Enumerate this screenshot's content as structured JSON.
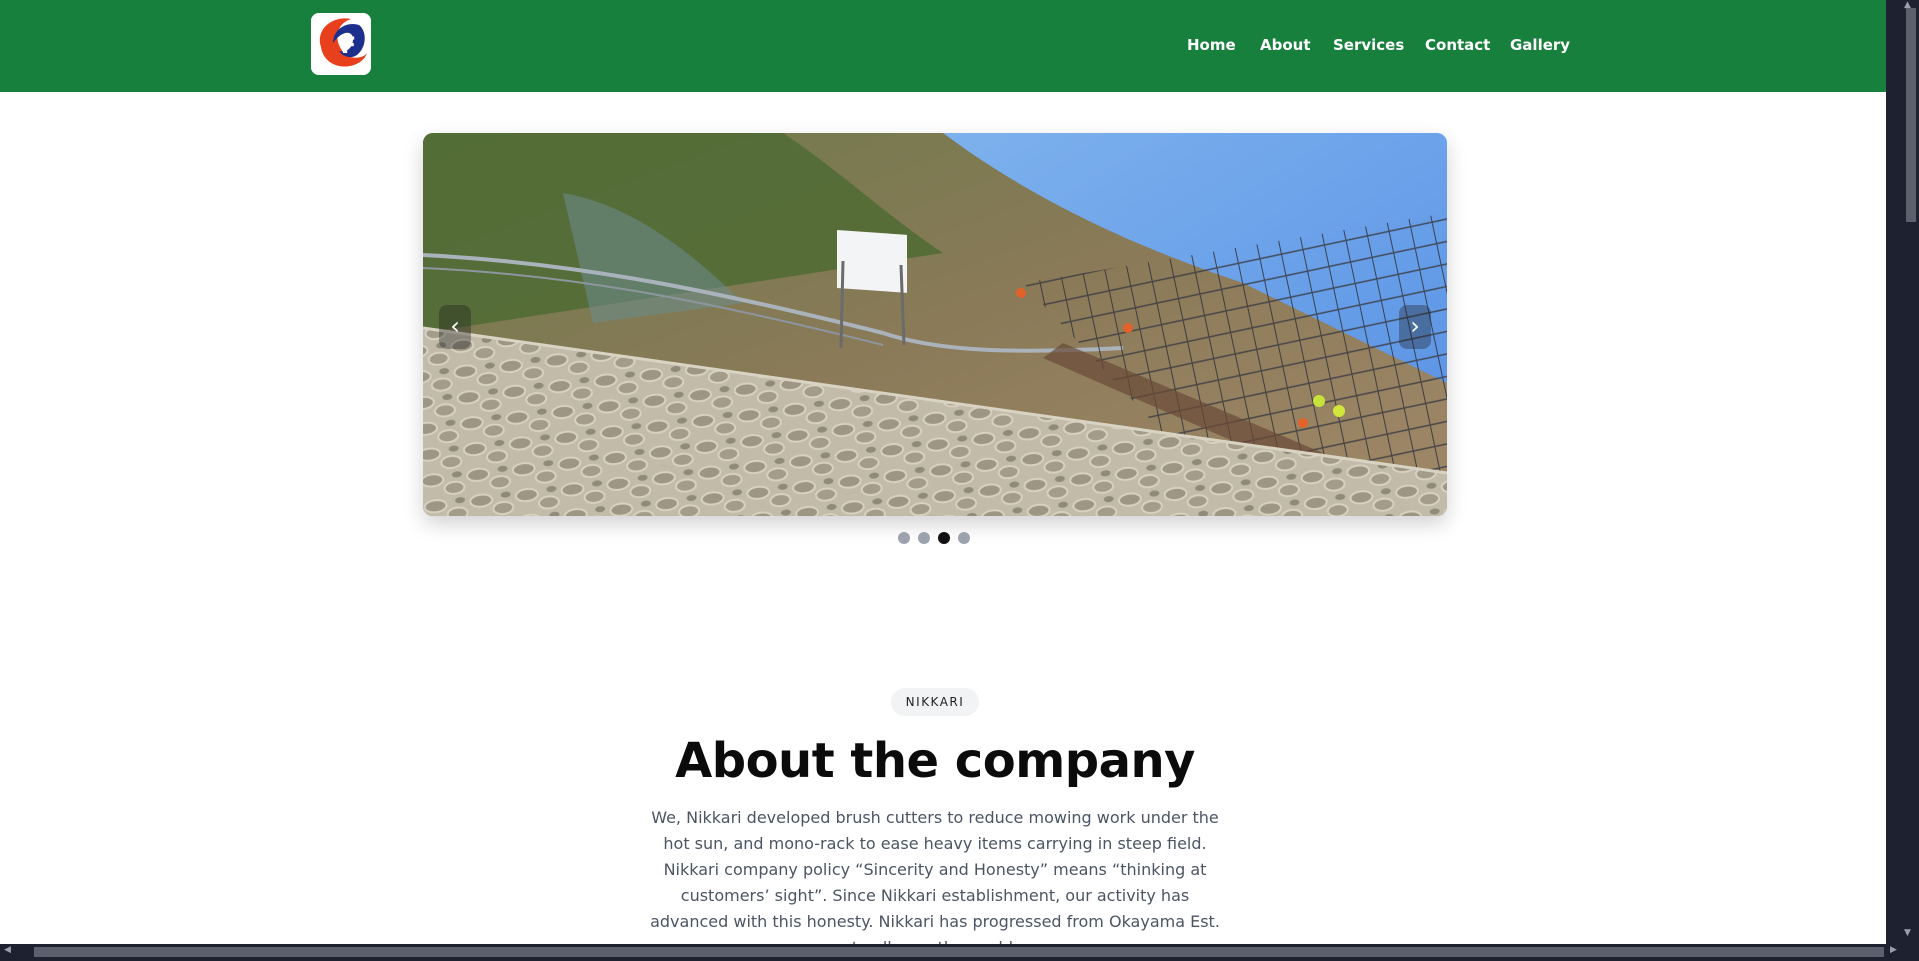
{
  "header": {
    "logo_alt": "Nikkari logo",
    "nav": [
      {
        "label": "Home"
      },
      {
        "label": "About"
      },
      {
        "label": "Services"
      },
      {
        "label": "Contact"
      },
      {
        "label": "Gallery"
      }
    ]
  },
  "carousel": {
    "prev_icon": "‹",
    "next_icon": "›",
    "slide_count": 4,
    "active_slide": 3
  },
  "about": {
    "badge": "NIKKARI",
    "title": "About the company",
    "text": "We, Nikkari developed brush cutters to reduce mowing work under the hot sun, and mono-rack to ease heavy items carrying in steep field. Nikkari company policy “Sincerity and Honesty” means “thinking at customers’ sight”. Since Nikkari establishment, our activity has advanced with this honesty. Nikkari has progressed from Okayama Est. to all over the world,"
  },
  "colors": {
    "header_bg": "#16803c",
    "text_muted": "#4b5563",
    "dot_active": "#111111",
    "dot_inactive": "#9ca3af"
  }
}
